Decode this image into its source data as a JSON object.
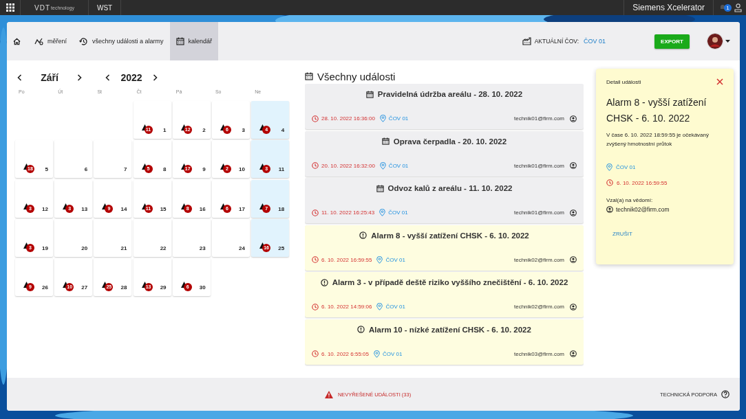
{
  "topbar": {
    "logo": "VDT",
    "logo_sub": "technology",
    "app": "WST",
    "brand": "Siemens Xcelerator",
    "notifications": "1"
  },
  "nav": {
    "items": [
      {
        "kind": "home",
        "selected": false
      },
      {
        "label": "měření",
        "kind": "chart",
        "selected": false
      },
      {
        "label": "všechny události a alarmy",
        "kind": "history",
        "selected": false
      },
      {
        "label": "kalendář",
        "kind": "calendar",
        "selected": true
      }
    ],
    "plant_label": "AKTUÁLNÍ ČOV:",
    "plant_value": "ČOV 01",
    "export": "EXPORT"
  },
  "calendar": {
    "month": "Září",
    "year": "2022",
    "weekdays": [
      "Po",
      "Út",
      "St",
      "Čt",
      "Pá",
      "So",
      "Ne"
    ],
    "weeks": [
      {
        "days": [
          {
            "kind": "blank"
          },
          {
            "kind": "blank"
          },
          {
            "kind": "blank"
          },
          {
            "kind": "day",
            "day": "1",
            "count": "11",
            "highlighted": false
          },
          {
            "kind": "day",
            "day": "2",
            "count": "12",
            "highlighted": false
          },
          {
            "kind": "day",
            "day": "3",
            "count": "6",
            "highlighted": false
          },
          {
            "kind": "day",
            "day": "4",
            "count": "4",
            "highlighted": true
          }
        ]
      },
      {
        "days": [
          {
            "kind": "day",
            "day": "5",
            "count": "18",
            "highlighted": false
          },
          {
            "kind": "day",
            "day": "6",
            "highlighted": false
          },
          {
            "kind": "day",
            "day": "7",
            "highlighted": false
          },
          {
            "kind": "day",
            "day": "8",
            "count": "5",
            "highlighted": false
          },
          {
            "kind": "day",
            "day": "9",
            "count": "17",
            "highlighted": false
          },
          {
            "kind": "day",
            "day": "10",
            "count": "2",
            "highlighted": false
          },
          {
            "kind": "day",
            "day": "11",
            "count": "3",
            "highlighted": true
          }
        ]
      },
      {
        "days": [
          {
            "kind": "day",
            "day": "12",
            "count": "3",
            "highlighted": false
          },
          {
            "kind": "day",
            "day": "13",
            "count": "3",
            "highlighted": false
          },
          {
            "kind": "day",
            "day": "14",
            "count": "9",
            "highlighted": false
          },
          {
            "kind": "day",
            "day": "15",
            "count": "11",
            "highlighted": false
          },
          {
            "kind": "day",
            "day": "16",
            "count": "8",
            "highlighted": false
          },
          {
            "kind": "day",
            "day": "17",
            "count": "6",
            "highlighted": false
          },
          {
            "kind": "day",
            "day": "18",
            "count": "7",
            "highlighted": true
          }
        ]
      },
      {
        "days": [
          {
            "kind": "day",
            "day": "19",
            "count": "3",
            "highlighted": false
          },
          {
            "kind": "day",
            "day": "20",
            "highlighted": false
          },
          {
            "kind": "day",
            "day": "21",
            "highlighted": false
          },
          {
            "kind": "day",
            "day": "22",
            "highlighted": false
          },
          {
            "kind": "day",
            "day": "23",
            "highlighted": false
          },
          {
            "kind": "day",
            "day": "24",
            "highlighted": false
          },
          {
            "kind": "day",
            "day": "25",
            "count": "16",
            "highlighted": true
          }
        ]
      },
      {
        "days": [
          {
            "kind": "day",
            "day": "26",
            "count": "9",
            "highlighted": false
          },
          {
            "kind": "day",
            "day": "27",
            "count": "10",
            "highlighted": false
          },
          {
            "kind": "day",
            "day": "28",
            "count": "25",
            "highlighted": false
          },
          {
            "kind": "day",
            "day": "29",
            "count": "13",
            "highlighted": false
          },
          {
            "kind": "day",
            "day": "30",
            "count": "6",
            "highlighted": false
          }
        ]
      }
    ]
  },
  "events": {
    "title": "Všechny události",
    "items": [
      {
        "kind": "event",
        "title": "Pravidelná údržba areálu - 28. 10. 2022",
        "time": "28. 10. 2022 16:36:00",
        "location": "ČOV 01",
        "user": "technik01@firm.com"
      },
      {
        "kind": "event",
        "title": "Oprava čerpadla - 20. 10. 2022",
        "time": "20. 10. 2022 16:32:00",
        "location": "ČOV 01",
        "user": "technik01@firm.com"
      },
      {
        "kind": "event",
        "title": "Odvoz kalů z areálu - 11. 10. 2022",
        "time": "11. 10. 2022 16:25:43",
        "location": "ČOV 01",
        "user": "technik01@firm.com"
      },
      {
        "kind": "alarm",
        "title": "Alarm 8 - vyšší zatížení CHSK - 6. 10. 2022",
        "time": "6. 10. 2022 16:59:55",
        "location": "ČOV 01",
        "user": "technik02@firm.com"
      },
      {
        "kind": "alarm",
        "title": "Alarm 3 - v případě deště riziko vyššího znečištění - 6. 10. 2022",
        "time": "6. 10. 2022 14:59:06",
        "location": "ČOV 01",
        "user": "technik02@firm.com"
      },
      {
        "kind": "alarm",
        "title": "Alarm 10 - nízké zatížení CHSK - 6. 10. 2022",
        "time": "6. 10. 2022 6:55:05",
        "location": "ČOV 01",
        "user": "technik03@firm.com"
      }
    ]
  },
  "detail": {
    "heading": "Detail události",
    "title": "Alarm 8 - vyšší zatížení CHSK - 6. 10. 2022",
    "description": "V čase 6. 10. 2022 18:59:55 je očekávaný zvýšený hmotnostní průtok",
    "location": "ČOV 01",
    "time": "6. 10. 2022 16:59:55",
    "ack_label": "Vzal(a) na vědomí:",
    "ack_user": "technik02@firm.com",
    "cancel": "ZRUŠIT"
  },
  "footer": {
    "unresolved": "NEVYŘEŠENÉ UDÁLOSTI (33)",
    "support": "TECHNICKÁ PODPORA"
  }
}
